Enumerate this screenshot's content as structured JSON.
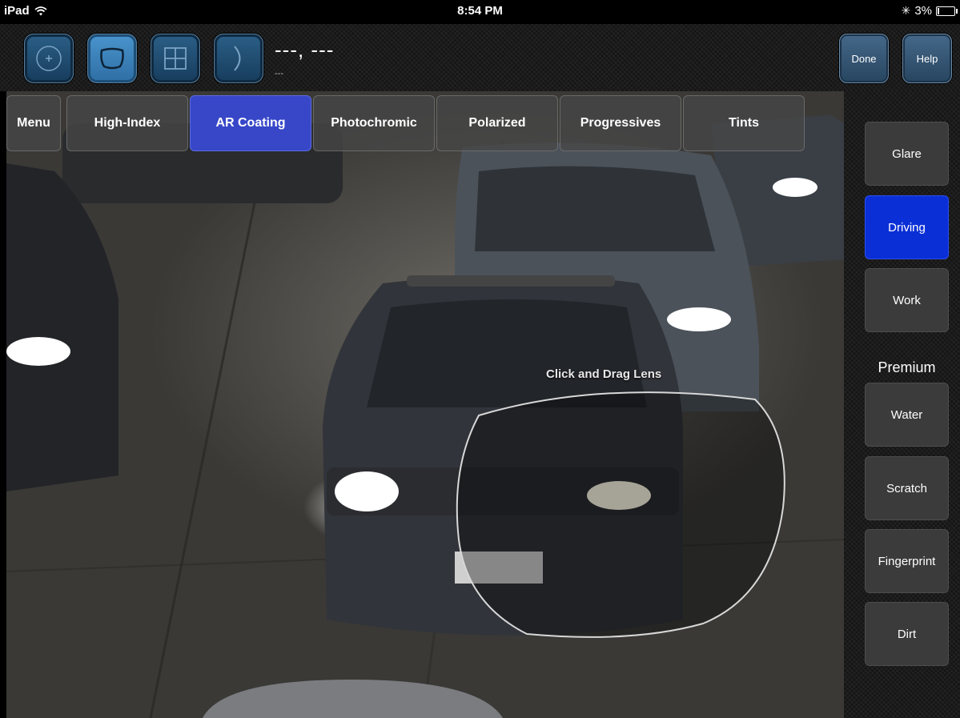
{
  "status_bar": {
    "device": "iPad",
    "time": "8:54 PM",
    "battery": "3%",
    "battery_level": 0.03
  },
  "toolbar": {
    "frame_buttons": [
      {
        "icon": "circle-plus-icon",
        "active": false
      },
      {
        "icon": "frame-shape-icon",
        "active": true
      },
      {
        "icon": "grid-icon",
        "active": false
      },
      {
        "icon": "curve-lens-icon",
        "active": false
      }
    ],
    "coordinates": "---, ---",
    "coordinates_sub": "---",
    "done_label": "Done",
    "help_label": "Help"
  },
  "menu": {
    "tabs": [
      {
        "label": "Menu",
        "active": false
      },
      {
        "label": "High-Index",
        "active": false
      },
      {
        "label": "AR Coating",
        "active": true
      },
      {
        "label": "Photochromic",
        "active": false
      },
      {
        "label": "Polarized",
        "active": false
      },
      {
        "label": "Progressives",
        "active": false
      },
      {
        "label": "Tints",
        "active": false
      }
    ]
  },
  "scene": {
    "hint": "Click and Drag Lens"
  },
  "sidebar": {
    "buttons": [
      {
        "label": "Glare",
        "active": false
      },
      {
        "label": "Driving",
        "active": true
      },
      {
        "label": "Work",
        "active": false
      }
    ],
    "premium_label": "Premium",
    "premium_buttons": [
      {
        "label": "Water"
      },
      {
        "label": "Scratch"
      },
      {
        "label": "Fingerprint"
      },
      {
        "label": "Dirt"
      }
    ]
  },
  "colors": {
    "accent_blue": "#3747c8",
    "sidebar_active": "#0b2fd6",
    "frame_button": "#2b5f87"
  }
}
